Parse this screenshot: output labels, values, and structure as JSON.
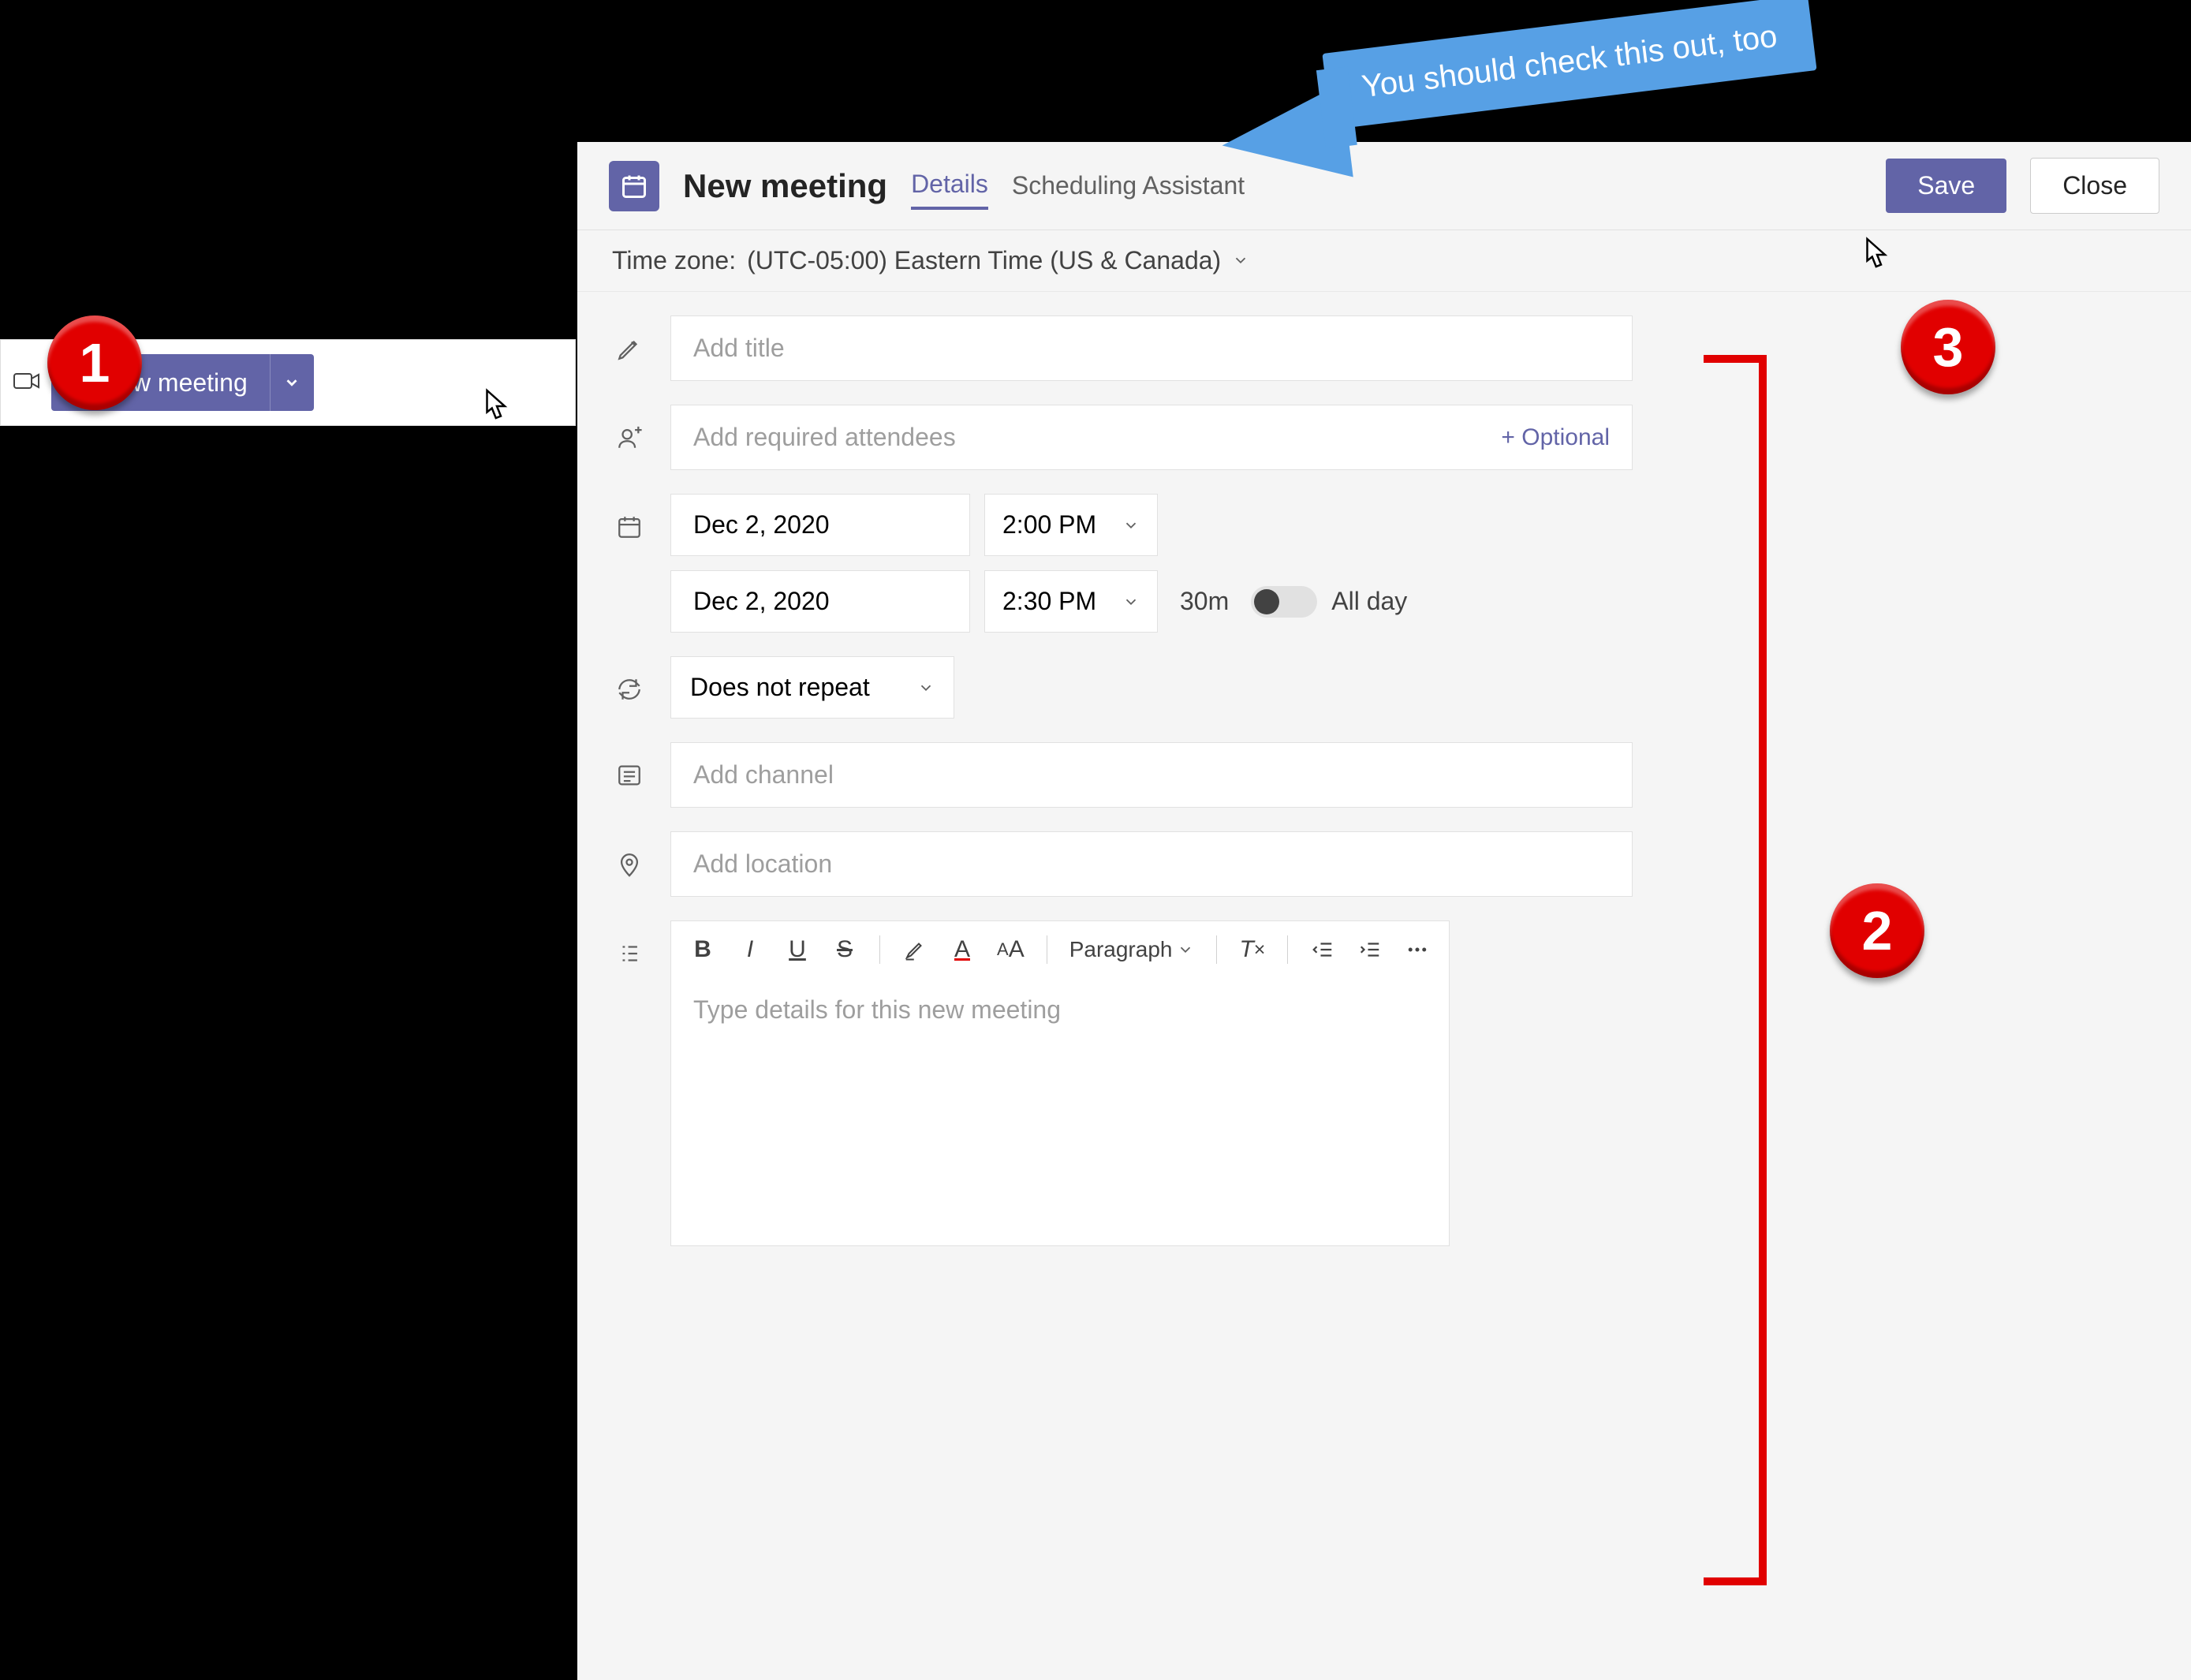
{
  "toolbar": {
    "new_meeting_label": "New meeting"
  },
  "header": {
    "title": "New meeting",
    "tab_details": "Details",
    "tab_scheduling": "Scheduling Assistant",
    "save_label": "Save",
    "close_label": "Close"
  },
  "timezone": {
    "label": "Time zone:",
    "value": "(UTC-05:00) Eastern Time (US & Canada)"
  },
  "form": {
    "title_placeholder": "Add title",
    "attendees_placeholder": "Add required attendees",
    "optional_label": "+ Optional",
    "start_date": "Dec 2, 2020",
    "start_time": "2:00 PM",
    "end_date": "Dec 2, 2020",
    "end_time": "2:30 PM",
    "duration": "30m",
    "all_day_label": "All day",
    "repeat_value": "Does not repeat",
    "channel_placeholder": "Add channel",
    "location_placeholder": "Add location",
    "rte_paragraph": "Paragraph",
    "rte_placeholder": "Type details for this new meeting"
  },
  "annotations": {
    "badge1": "1",
    "badge2": "2",
    "badge3": "3",
    "callout": "You should check this out, too"
  }
}
